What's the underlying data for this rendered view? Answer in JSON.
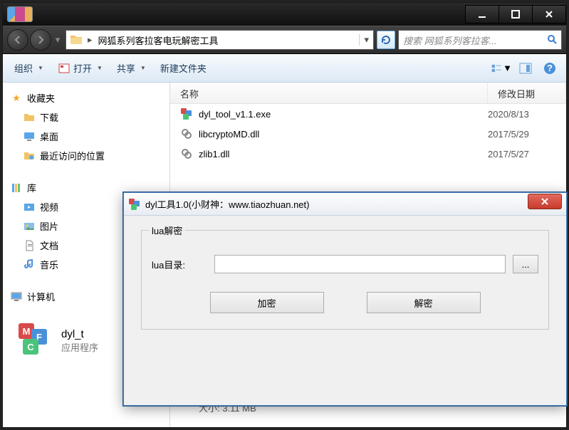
{
  "explorer": {
    "breadcrumb": "网狐系列客拉客电玩解密工具",
    "search_placeholder": "搜索 网狐系列客拉客...",
    "toolbar": {
      "organize": "组织",
      "open": "打开",
      "share": "共享",
      "new_folder": "新建文件夹"
    },
    "sidebar": {
      "favorites": "收藏夹",
      "downloads": "下载",
      "desktop": "桌面",
      "recent": "最近访问的位置",
      "libraries": "库",
      "videos": "视频",
      "pictures": "图片",
      "documents": "文档",
      "music": "音乐",
      "computer": "计算机"
    },
    "columns": {
      "name": "名称",
      "modified": "修改日期"
    },
    "files": [
      {
        "name": "dyl_tool_v1.1.exe",
        "date": "2020/8/13",
        "icon": "mfc"
      },
      {
        "name": "libcryptoMD.dll",
        "date": "2017/5/29",
        "icon": "dll"
      },
      {
        "name": "zlib1.dll",
        "date": "2017/5/27",
        "icon": "dll"
      }
    ],
    "selected": {
      "name": "dyl_t",
      "type": "应用程序",
      "size_label": "大小: 3.11 MB"
    }
  },
  "dialog": {
    "title": "dyl工具1.0(小财神：www.tiaozhuan.net)",
    "group_legend": "lua解密",
    "dir_label": "lua目录:",
    "dir_value": "",
    "browse": "...",
    "encrypt_btn": "加密",
    "decrypt_btn": "解密"
  }
}
